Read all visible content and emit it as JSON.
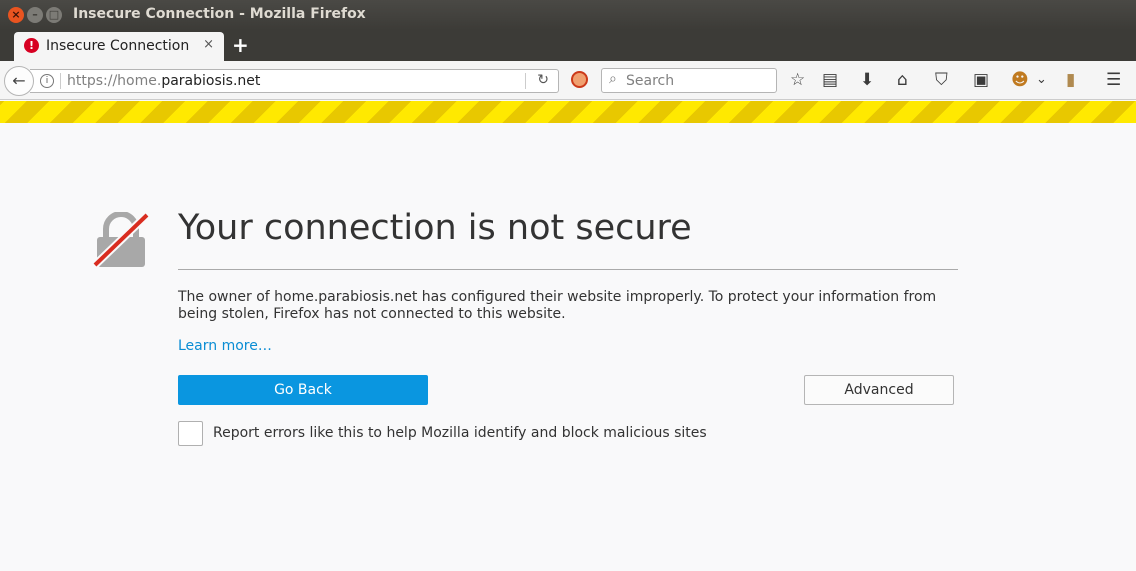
{
  "window": {
    "title": "Insecure Connection - Mozilla Firefox",
    "buttons": {
      "close": "×",
      "minimize": "–",
      "maximize": "□"
    }
  },
  "tabs": [
    {
      "label": "Insecure Connection",
      "icon": "error-icon",
      "close": "×"
    }
  ],
  "new_tab_label": "+",
  "navbar": {
    "back_icon": "←",
    "info_icon": "i",
    "url_prefix": "https://home.",
    "url_domain": "parabiosis.net",
    "reload_icon": "↻",
    "search_icon": "⌕",
    "search_placeholder": "Search",
    "toolbar_icons": {
      "bookmark_star": "☆",
      "library": "▤",
      "downloads": "⬇",
      "home": "⌂",
      "pocket": "⛉",
      "screenshot": "▣",
      "addon": "☻",
      "dropdown": "⌄",
      "notes": "▮",
      "menu": "☰"
    }
  },
  "colors": {
    "accent": "#0a96e0",
    "link": "#0a8dd4",
    "stripe": "#ffe900",
    "error": "#d70022"
  },
  "error_page": {
    "title": "Your connection is not secure",
    "description": "The owner of home.parabiosis.net has configured their website improperly. To protect your information from being stolen, Firefox has not connected to this website.",
    "learn_more": "Learn more…",
    "go_back": "Go Back",
    "advanced": "Advanced",
    "report_label": "Report errors like this to help Mozilla identify and block malicious sites",
    "report_checked": false
  }
}
